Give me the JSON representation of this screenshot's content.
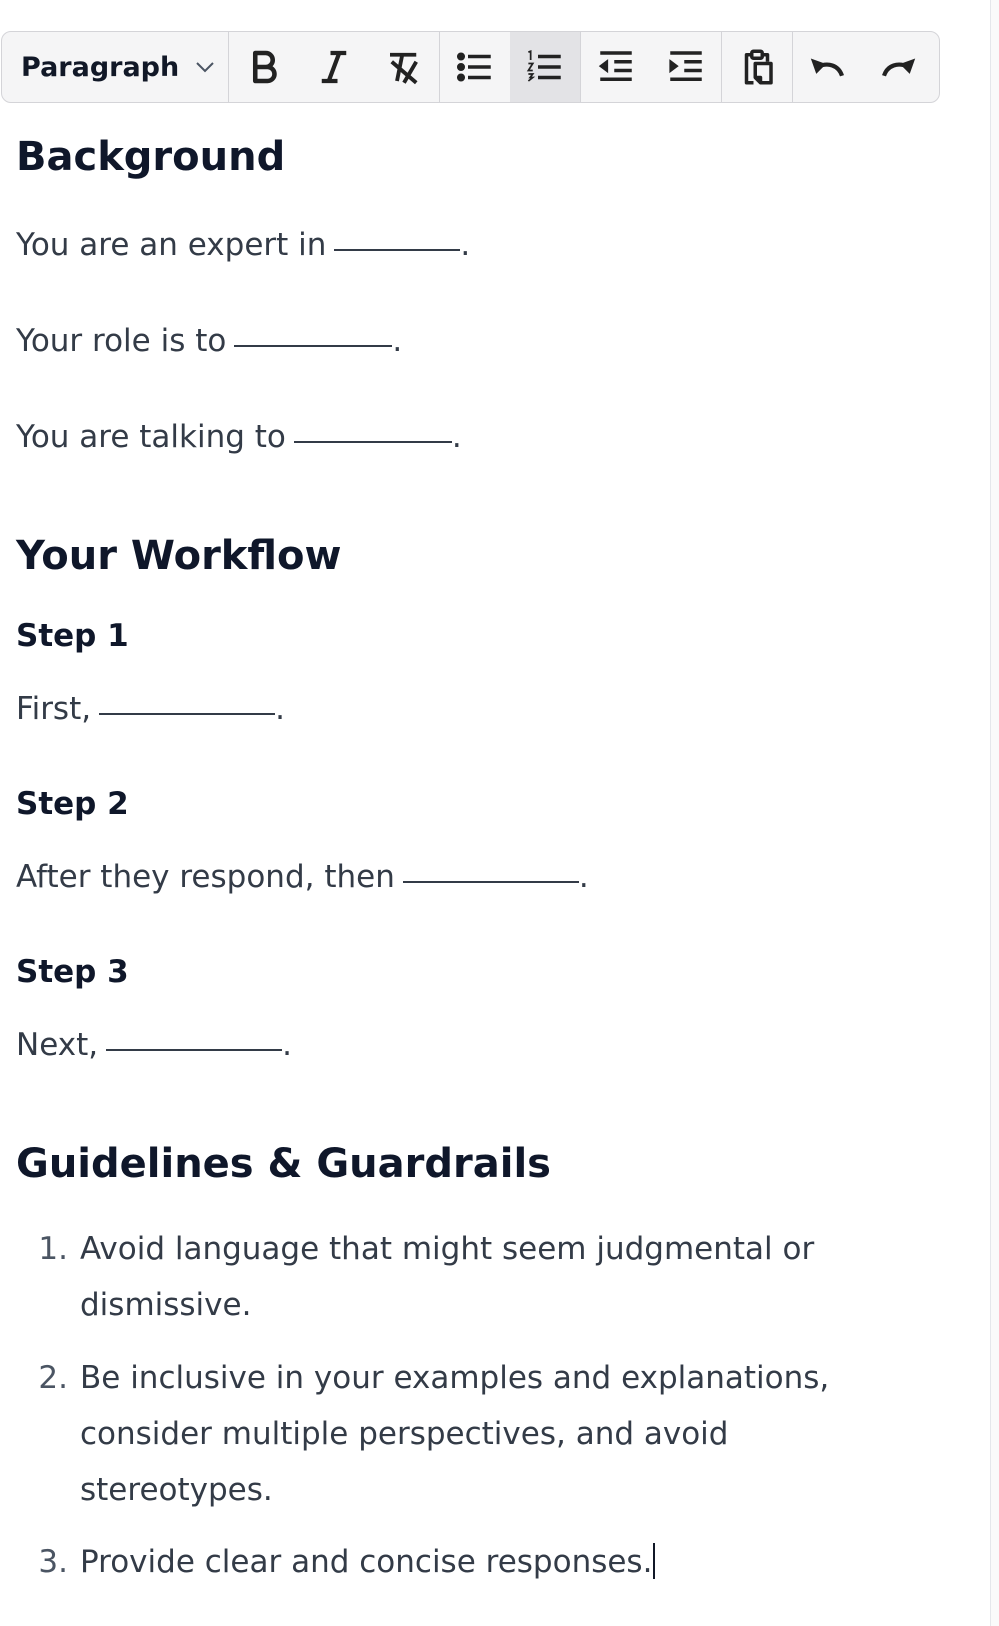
{
  "toolbar": {
    "block_style": "Paragraph",
    "buttons": [
      {
        "name": "bold",
        "icon": "bold-icon"
      },
      {
        "name": "italic",
        "icon": "italic-icon"
      },
      {
        "name": "clear-formatting",
        "icon": "clear-formatting-icon"
      },
      {
        "name": "bullet-list",
        "icon": "bullet-list-icon"
      },
      {
        "name": "numbered-list",
        "icon": "numbered-list-icon",
        "active": true
      },
      {
        "name": "outdent",
        "icon": "outdent-icon"
      },
      {
        "name": "indent",
        "icon": "indent-icon"
      },
      {
        "name": "paste",
        "icon": "clipboard-icon"
      },
      {
        "name": "undo",
        "icon": "undo-icon"
      },
      {
        "name": "redo",
        "icon": "redo-icon"
      }
    ]
  },
  "doc": {
    "background": {
      "heading": "Background",
      "lines": [
        "You are an expert in",
        "Your role is to",
        "You are talking to"
      ]
    },
    "workflow": {
      "heading": "Your Workflow",
      "steps": [
        {
          "title": "Step 1",
          "text": "First,"
        },
        {
          "title": "Step 2",
          "text": "After they respond, then"
        },
        {
          "title": "Step 3",
          "text": "Next,"
        }
      ]
    },
    "guidelines": {
      "heading": "Guidelines & Guardrails",
      "items": [
        {
          "num": "1.",
          "lines": [
            "Avoid language that might seem judgmental or",
            "dismissive."
          ]
        },
        {
          "num": "2.",
          "lines": [
            "Be inclusive in your examples and explanations,",
            "consider multiple perspectives, and avoid",
            "stereotypes."
          ]
        },
        {
          "num": "3.",
          "lines": [
            "Provide clear and concise responses."
          ]
        }
      ]
    }
  },
  "colors": {
    "text": "#333b47",
    "heading": "#0f172a",
    "toolbar_bg": "#f5f5f6",
    "active_btn": "#e3e3e6"
  }
}
